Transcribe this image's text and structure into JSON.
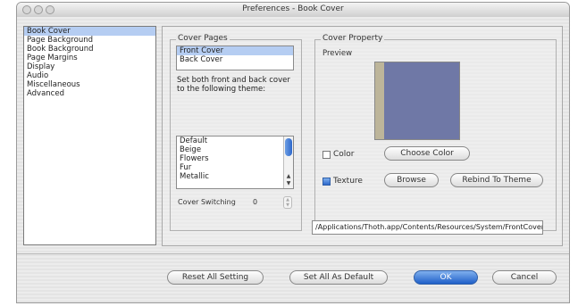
{
  "window": {
    "title": "Preferences - Book Cover"
  },
  "categories": [
    "Book Cover",
    "Page Background",
    "Book Background",
    "Page Margins",
    "Display",
    "Audio",
    "Miscellaneous",
    "Advanced"
  ],
  "selected_category": "Book Cover",
  "cover_pages": {
    "label": "Cover Pages",
    "items": [
      "Front Cover",
      "Back Cover"
    ],
    "selected": "Front Cover",
    "description": "Set both front and back cover to the following theme:",
    "themes": [
      "Default",
      "Beige",
      "Flowers",
      "Fur",
      "Metallic"
    ],
    "theme_selected": "Default",
    "cover_switching_label": "Cover Switching",
    "cover_switching_value": "0"
  },
  "cover_property": {
    "label": "Cover Property",
    "preview_label": "Preview",
    "color_label": "Color",
    "color_checked": false,
    "texture_label": "Texture",
    "texture_checked": true,
    "choose_color_button": "Choose Color",
    "browse_button": "Browse",
    "rebind_button": "Rebind To Theme",
    "texture_path": "/Applications/Thoth.app/Contents/Resources/System/FrontCover.jpg"
  },
  "footer": {
    "reset_button": "Reset All Setting",
    "default_button": "Set All As Default",
    "ok_button": "OK",
    "cancel_button": "Cancel"
  },
  "colors": {
    "selection": "#b5cdf2",
    "preview_cover": "#6f78a6",
    "preview_spine": "#bdb59a",
    "default_button": "#2d68cc"
  }
}
